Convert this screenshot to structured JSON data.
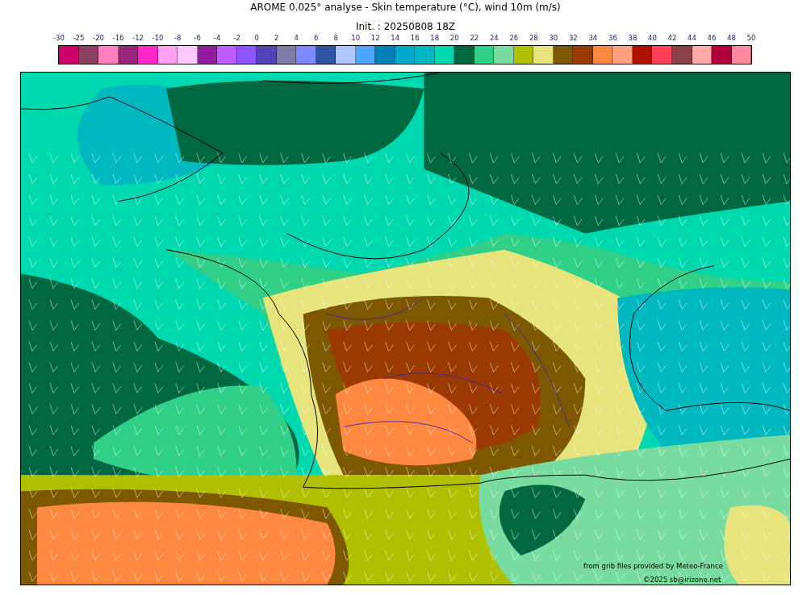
{
  "title": "AROME 0.025° analyse - Skin temperature (°C), wind 10m (m/s)",
  "subtitle": "Init. : 20250808 18Z",
  "colorbar": {
    "ticks": [
      "-30",
      "-25",
      "-20",
      "-16",
      "-12",
      "-10",
      "-8",
      "-6",
      "-4",
      "-2",
      "0",
      "2",
      "4",
      "6",
      "8",
      "10",
      "12",
      "14",
      "16",
      "18",
      "20",
      "22",
      "24",
      "26",
      "28",
      "30",
      "32",
      "34",
      "36",
      "38",
      "40",
      "42",
      "44",
      "46",
      "48",
      "50"
    ],
    "cells": [
      {
        "color": "#cc0066"
      },
      {
        "color": "#8b4060"
      },
      {
        "color": "#ff80c0"
      },
      {
        "color": "#99267a"
      },
      {
        "color": "#ff26c8"
      },
      {
        "color": "#ffa0f0"
      },
      {
        "color": "#ffc8ff"
      },
      {
        "color": "#8e1e9e"
      },
      {
        "color": "#bf5cff"
      },
      {
        "color": "#8f55ff"
      },
      {
        "color": "#5044b8"
      },
      {
        "color": "#807ca8"
      },
      {
        "color": "#8088ff"
      },
      {
        "color": "#2e55a0"
      },
      {
        "color": "#b0c8ff"
      },
      {
        "color": "#4ca8ff"
      },
      {
        "color": "#0080b8"
      },
      {
        "color": "#00a8cc"
      },
      {
        "color": "#00b8c0"
      },
      {
        "color": "#00d8b0"
      },
      {
        "color": "#006840"
      },
      {
        "color": "#30d088"
      },
      {
        "color": "#78dca0"
      },
      {
        "color": "#b0c000"
      },
      {
        "color": "#e6e47a"
      },
      {
        "color": "#7e5800"
      },
      {
        "color": "#9a3a00"
      },
      {
        "color": "#ff8840"
      },
      {
        "color": "#ffa080"
      },
      {
        "color": "#b01000"
      },
      {
        "color": "#ff4058"
      },
      {
        "color": "#8a4048"
      },
      {
        "color": "#ffa8a8"
      },
      {
        "color": "#b00038"
      },
      {
        "color": "#ff8aa0"
      }
    ]
  },
  "map": {
    "source_note": "from grib files provided by Meteo-France",
    "copyright": "©2025 sb@irizone.net"
  }
}
